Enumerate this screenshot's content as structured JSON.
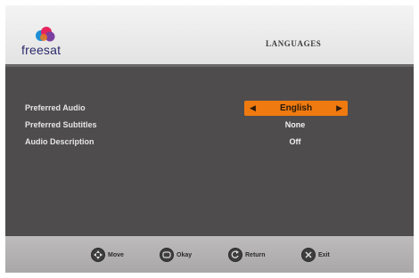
{
  "header": {
    "brand": "freesat",
    "title": "LANGUAGES"
  },
  "settings": [
    {
      "label": "Preferred Audio",
      "value": "English",
      "selected": true
    },
    {
      "label": "Preferred Subtitles",
      "value": "None",
      "selected": false
    },
    {
      "label": "Audio Description",
      "value": "Off",
      "selected": false
    }
  ],
  "footer": {
    "hints": [
      {
        "icon": "dpad-icon",
        "label": "Move"
      },
      {
        "icon": "ok-button-icon",
        "label": "Okay"
      },
      {
        "icon": "back-button-icon",
        "label": "Return"
      },
      {
        "icon": "exit-button-icon",
        "label": "Exit"
      }
    ]
  },
  "colors": {
    "accent": "#ef7a10",
    "background": "#4e4c4d",
    "header": "#eeeeee",
    "footer": "#b4b2b2"
  }
}
